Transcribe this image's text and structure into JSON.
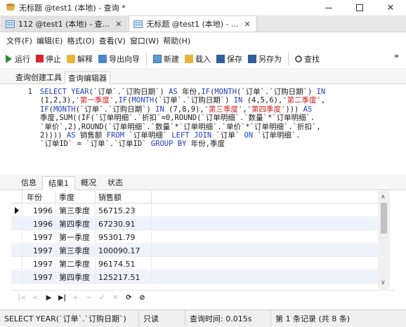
{
  "window": {
    "title": "无标题 @test1 (本地) - 查询 *",
    "controls": {
      "minimize": "—",
      "maximize": "□",
      "close": "✕"
    }
  },
  "tabs": [
    {
      "label": "112 @test1 (本地) - 查...",
      "close": "✕"
    },
    {
      "label": "无标题 @test1 (本地) - ...",
      "close": "✕"
    }
  ],
  "menu": [
    "文件(F)",
    "编辑(E)",
    "格式(O)",
    "查看(V)",
    "窗口(W)",
    "帮助(H)"
  ],
  "toolbar": {
    "run": "运行",
    "stop": "停止",
    "explain": "解释",
    "export": "导出向导",
    "new": "新建",
    "load": "载入",
    "save": "保存",
    "saveas": "另存为",
    "find": "查找",
    "more": "»"
  },
  "subtabs": [
    "查询创建工具",
    "查询编辑器"
  ],
  "editor": {
    "line_number": "1",
    "lines": [
      [
        [
          "kw",
          "SELECT YEAR"
        ],
        [
          "tx",
          "(`订单`.`订购日期`) "
        ],
        [
          "kw",
          "AS"
        ],
        [
          "tx",
          " 年份,"
        ],
        [
          "kw",
          "IF"
        ],
        [
          "tx",
          "("
        ],
        [
          "kw",
          "MONTH"
        ],
        [
          "tx",
          "(`订单`.`订购日期`) "
        ],
        [
          "kw",
          "IN"
        ]
      ],
      [
        [
          "tx",
          "(1,2,3),"
        ],
        [
          "str",
          "'第一季度'"
        ],
        [
          "tx",
          ","
        ],
        [
          "kw",
          "IF"
        ],
        [
          "tx",
          "("
        ],
        [
          "kw",
          "MONTH"
        ],
        [
          "tx",
          "(`订单`.`订购日期`) "
        ],
        [
          "kw",
          "IN"
        ],
        [
          "tx",
          " (4,5,6),"
        ],
        [
          "str",
          "'第二季度'"
        ],
        [
          "tx",
          ","
        ]
      ],
      [
        [
          "kw",
          "IF"
        ],
        [
          "tx",
          "("
        ],
        [
          "kw",
          "MONTH"
        ],
        [
          "tx",
          "(`订单`.`订购日期`) "
        ],
        [
          "kw",
          "IN"
        ],
        [
          "tx",
          " (7,8,9),"
        ],
        [
          "str",
          "'第三季度'"
        ],
        [
          "tx",
          ","
        ],
        [
          "str",
          "'第四季度'"
        ],
        [
          "tx",
          ")))"
        ],
        [
          "kw",
          " AS"
        ]
      ],
      [
        [
          "tx",
          "季度,SUM((IF(`订单明细`.`折扣`=0,ROUND(`订单明细`.`数量`*`订单明细`."
        ]
      ],
      [
        [
          "tx",
          "`单价`,2),ROUND(`订单明细`.`数量`*`订单明细`.`单价`*`订单明细`.`折扣`,"
        ]
      ],
      [
        [
          "tx",
          "2)))) "
        ],
        [
          "kw",
          "AS"
        ],
        [
          "tx",
          " 销售额 "
        ],
        [
          "kw",
          "FROM"
        ],
        [
          "tx",
          " `订单明细` "
        ],
        [
          "kw",
          "LEFT JOIN"
        ],
        [
          "tx",
          " `订单` "
        ],
        [
          "kw",
          "ON"
        ],
        [
          "tx",
          " `订单明细`."
        ]
      ],
      [
        [
          "tx",
          "`订单ID` = `订单`.`订单ID` "
        ],
        [
          "kw",
          "GROUP BY"
        ],
        [
          "tx",
          " 年份,季度"
        ]
      ]
    ]
  },
  "result_tabs": [
    "信息",
    "结果1",
    "概况",
    "状态"
  ],
  "grid": {
    "columns": [
      "年份",
      "季度",
      "销售额"
    ],
    "rows": [
      [
        "1996",
        "第三季度",
        "56715.23"
      ],
      [
        "1996",
        "第四季度",
        "67230.91"
      ],
      [
        "1997",
        "第一季度",
        "95301.79"
      ],
      [
        "1997",
        "第三季度",
        "100090.17"
      ],
      [
        "1997",
        "第二季度",
        "96174.51"
      ],
      [
        "1997",
        "第四季度",
        "125217.51"
      ]
    ]
  },
  "navigator": [
    "|<",
    "<",
    "▶",
    "▶|",
    "+",
    "−",
    "✓",
    "✕",
    "⟳",
    "⊘"
  ],
  "status": {
    "sql": "SELECT YEAR(`订单`.`订购日期`)",
    "mode": "只读",
    "time": "查询时间: 0.015s",
    "record": "第 1 条记录 (共 8 条)"
  }
}
